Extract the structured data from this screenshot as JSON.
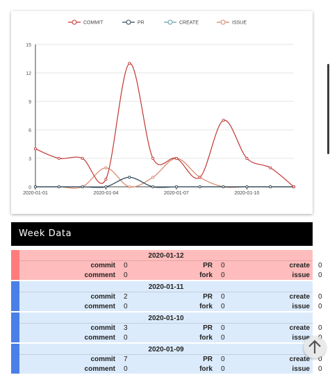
{
  "chart_data": {
    "type": "line",
    "x_labels": [
      "2020-01-01",
      "2020-01-04",
      "2020-01-07",
      "2020-01-10"
    ],
    "ylim": [
      0,
      15
    ],
    "y_ticks": [
      "0",
      "3",
      "6",
      "9",
      "12",
      "15"
    ],
    "legend_position": "top-center",
    "series": [
      {
        "name": "COMMIT",
        "color": "#c23531",
        "values": [
          4,
          3,
          3,
          0.8,
          13,
          3,
          3,
          1,
          7,
          3,
          2,
          0
        ]
      },
      {
        "name": "PR",
        "color": "#2f4554",
        "values": [
          0,
          0,
          0,
          0,
          1,
          0,
          0,
          0,
          0,
          0,
          0,
          0
        ]
      },
      {
        "name": "CREATE",
        "color": "#61a0a8",
        "values": [
          0,
          0,
          0,
          0,
          1,
          0,
          0,
          0,
          0,
          0,
          0,
          0
        ]
      },
      {
        "name": "ISSUE",
        "color": "#d48265",
        "values": [
          0,
          0,
          0,
          2,
          0,
          1,
          3,
          1,
          0,
          0,
          0,
          0
        ]
      }
    ]
  },
  "week": {
    "title": "Week Data",
    "days": [
      {
        "date": "2020-01-12",
        "accent": "#ff7b7b",
        "bg": "#ffbcbc",
        "commit": "0",
        "comment": "0",
        "pr": "0",
        "fork": "0",
        "create": "0",
        "issue": "0"
      },
      {
        "date": "2020-01-11",
        "accent": "#4a7fe8",
        "bg": "#dcebfb",
        "commit": "2",
        "comment": "0",
        "pr": "0",
        "fork": "0",
        "create": "0",
        "issue": "0"
      },
      {
        "date": "2020-01-10",
        "accent": "#4a7fe8",
        "bg": "#dcebfb",
        "commit": "3",
        "comment": "0",
        "pr": "0",
        "fork": "0",
        "create": "0",
        "issue": "0"
      },
      {
        "date": "2020-01-09",
        "accent": "#4a7fe8",
        "bg": "#dcebfb",
        "commit": "7",
        "comment": "0",
        "pr": "0",
        "fork": "0",
        "create": "0",
        "issue": "0"
      }
    ],
    "labels": {
      "commit": "commit",
      "comment": "comment",
      "pr": "PR",
      "fork": "fork",
      "create": "create",
      "issue": "issue"
    }
  },
  "icons": {
    "scroll_top": "arrow-up-icon"
  }
}
